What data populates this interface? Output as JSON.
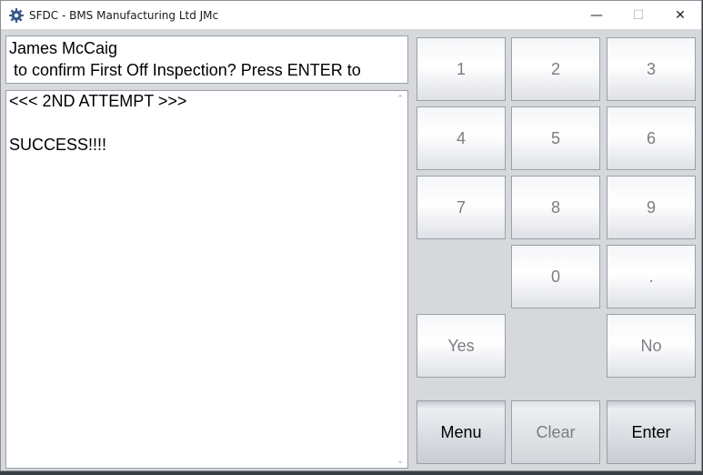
{
  "window": {
    "title": "SFDC - BMS Manufacturing Ltd JMc",
    "controls": {
      "minimize": "—",
      "maximize": "☐",
      "close": "✕"
    }
  },
  "header": {
    "line1": "James McCaig",
    "line2": " to confirm First Off Inspection? Press ENTER to"
  },
  "messages": [
    "<<< 2ND ATTEMPT >>>",
    "",
    "SUCCESS!!!!"
  ],
  "keypad": {
    "k1": "1",
    "k2": "2",
    "k3": "3",
    "k4": "4",
    "k5": "5",
    "k6": "6",
    "k7": "7",
    "k8": "8",
    "k9": "9",
    "k0": "0",
    "dot": ".",
    "yes": "Yes",
    "no": "No",
    "menu": "Menu",
    "clear": "Clear",
    "enter": "Enter"
  },
  "icons": {
    "scroll_up": "⌃",
    "scroll_down": "⌄"
  },
  "colors": {
    "title_bar": "#ffffff",
    "panel": "#d6d8dc",
    "key_text_disabled": "#7a7d82",
    "key_text_active": "#000000"
  }
}
